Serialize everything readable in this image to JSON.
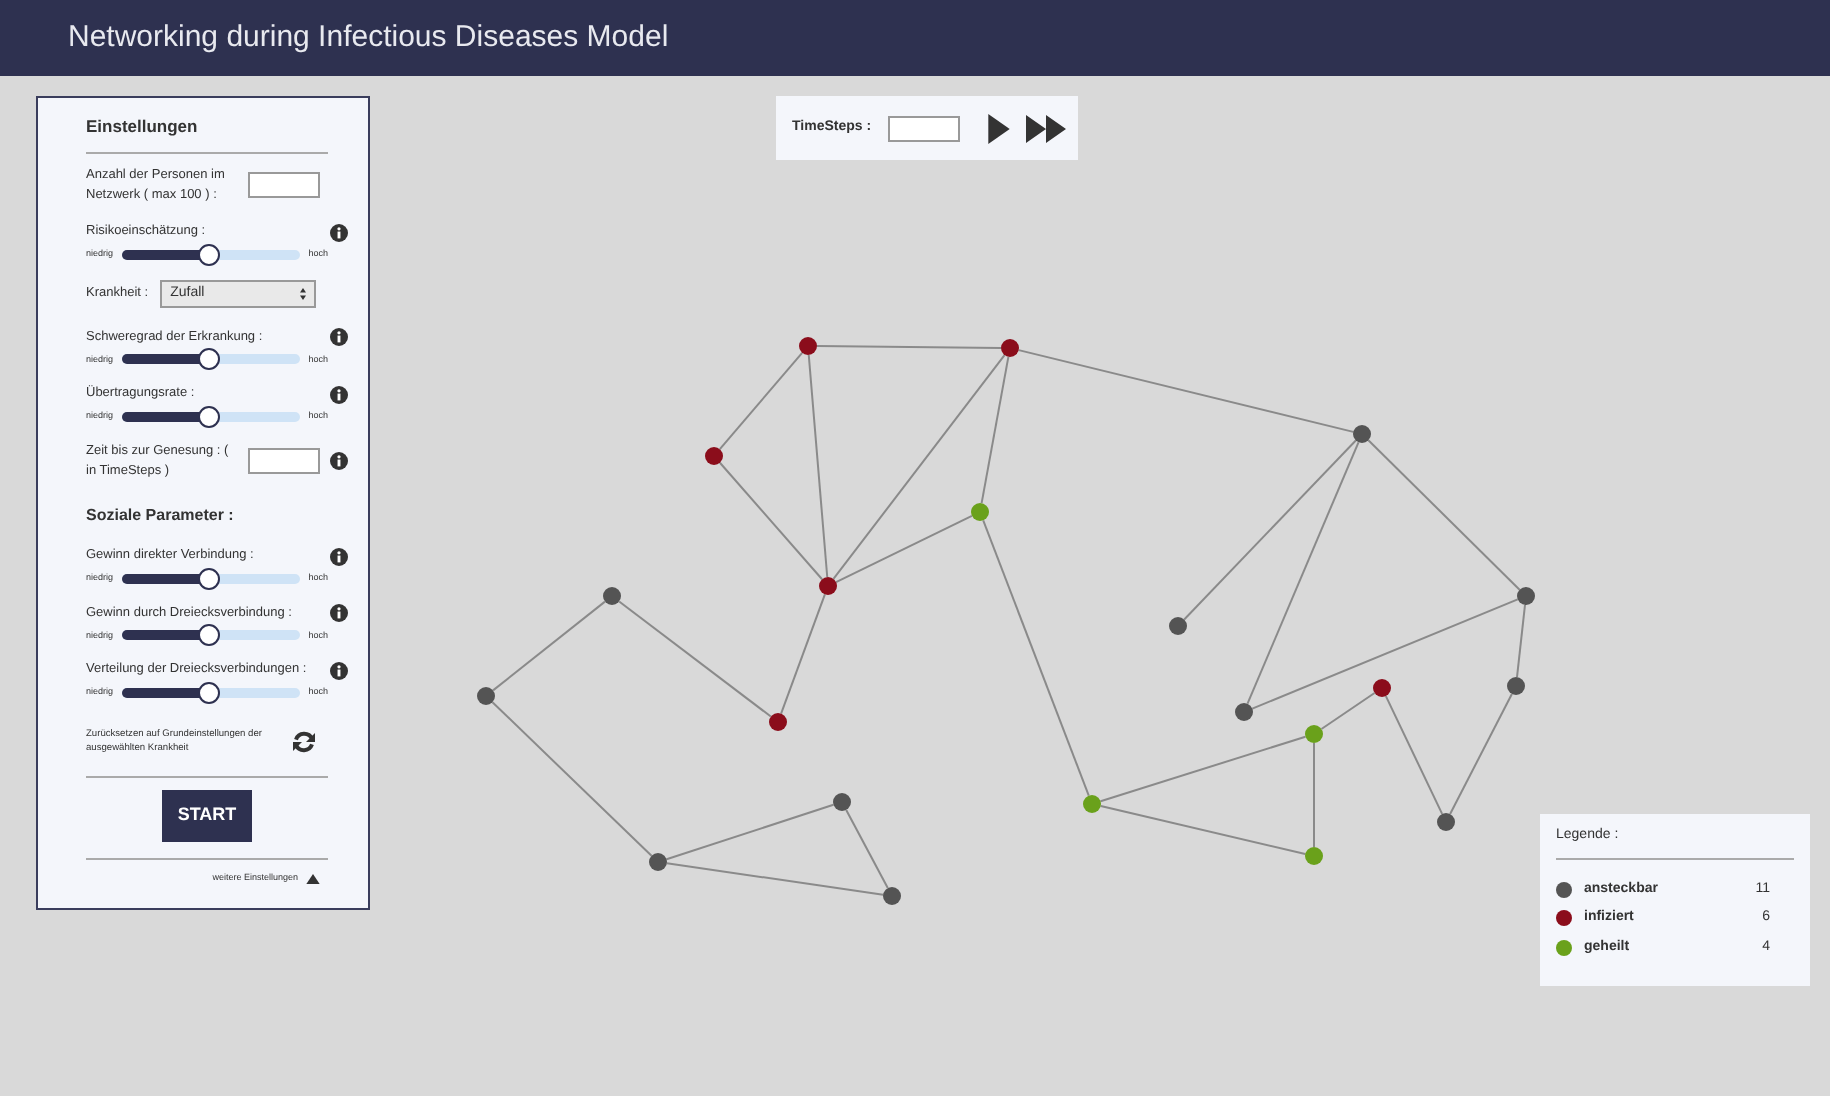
{
  "header": {
    "title": "Networking during Infectious Diseases Model"
  },
  "settings": {
    "title": "Einstellungen",
    "controls": [
      {
        "kind": "number",
        "label": "Anzahl der Personen im Netzwerk ( max 100 ) :",
        "info": false
      },
      {
        "kind": "slider",
        "label": "Risikoeinschätzung :",
        "info": true,
        "level": 0.48,
        "low": "niedrig",
        "high": "hoch"
      },
      {
        "kind": "select",
        "label": "Krankheit :",
        "value": "Zufall",
        "info": false
      },
      {
        "kind": "slider",
        "label": "Schweregrad der Erkrankung :",
        "info": true,
        "level": 0.48,
        "low": "niedrig",
        "high": "hoch"
      },
      {
        "kind": "slider",
        "label": "Übertragungsrate :",
        "info": true,
        "level": 0.48,
        "low": "niedrig",
        "high": "hoch"
      },
      {
        "kind": "number",
        "label": "Zeit bis zur Genesung : ( in TimeSteps )",
        "info": true
      }
    ],
    "section_title": "Soziale Parameter :",
    "social_controls": [
      {
        "kind": "slider",
        "label": "Gewinn direkter Verbindung :",
        "info": true,
        "level": 0.48,
        "low": "niedrig",
        "high": "hoch"
      },
      {
        "kind": "slider",
        "label": "Gewinn durch Dreiecksverbindung :",
        "info": true,
        "level": 0.48,
        "low": "niedrig",
        "high": "hoch"
      },
      {
        "kind": "slider",
        "label": "Verteilung der Dreiecksverbindungen :",
        "info": true,
        "level": 0.48,
        "low": "niedrig",
        "high": "hoch"
      }
    ],
    "reset_label": "Zurücksetzen auf Grundeinstellungen der ausgewählten Krankheit",
    "start_button": "START",
    "more_settings": "weitere Einstellungen"
  },
  "timesteps": {
    "label": "TimeSteps :"
  },
  "legend": {
    "title": "Legende :",
    "items": [
      {
        "label": "ansteckbar",
        "count": "11",
        "color": "#545454"
      },
      {
        "label": "infiziert",
        "count": "6",
        "color": "#8b0d1b"
      },
      {
        "label": "geheilt",
        "count": "4",
        "color": "#6aa11b"
      }
    ]
  },
  "network": {
    "nodes": [
      {
        "color": "#8b0d1b"
      },
      {
        "color": "#8b0d1b"
      },
      {
        "color": "#8b0d1b"
      },
      {
        "color": "#6aa11b"
      },
      {
        "color": "#8b0d1b"
      },
      {
        "color": "#545454"
      },
      {
        "color": "#8b0d1b"
      },
      {
        "color": "#545454"
      },
      {
        "color": "#545454"
      },
      {
        "color": "#545454"
      },
      {
        "color": "#545454"
      },
      {
        "color": "#6aa11b"
      },
      {
        "color": "#545454"
      },
      {
        "color": "#545454"
      },
      {
        "color": "#545454"
      },
      {
        "color": "#545454"
      },
      {
        "color": "#8b0d1b"
      },
      {
        "color": "#545454"
      },
      {
        "color": "#6aa11b"
      },
      {
        "color": "#6aa11b"
      },
      {
        "color": "#545454"
      }
    ]
  }
}
